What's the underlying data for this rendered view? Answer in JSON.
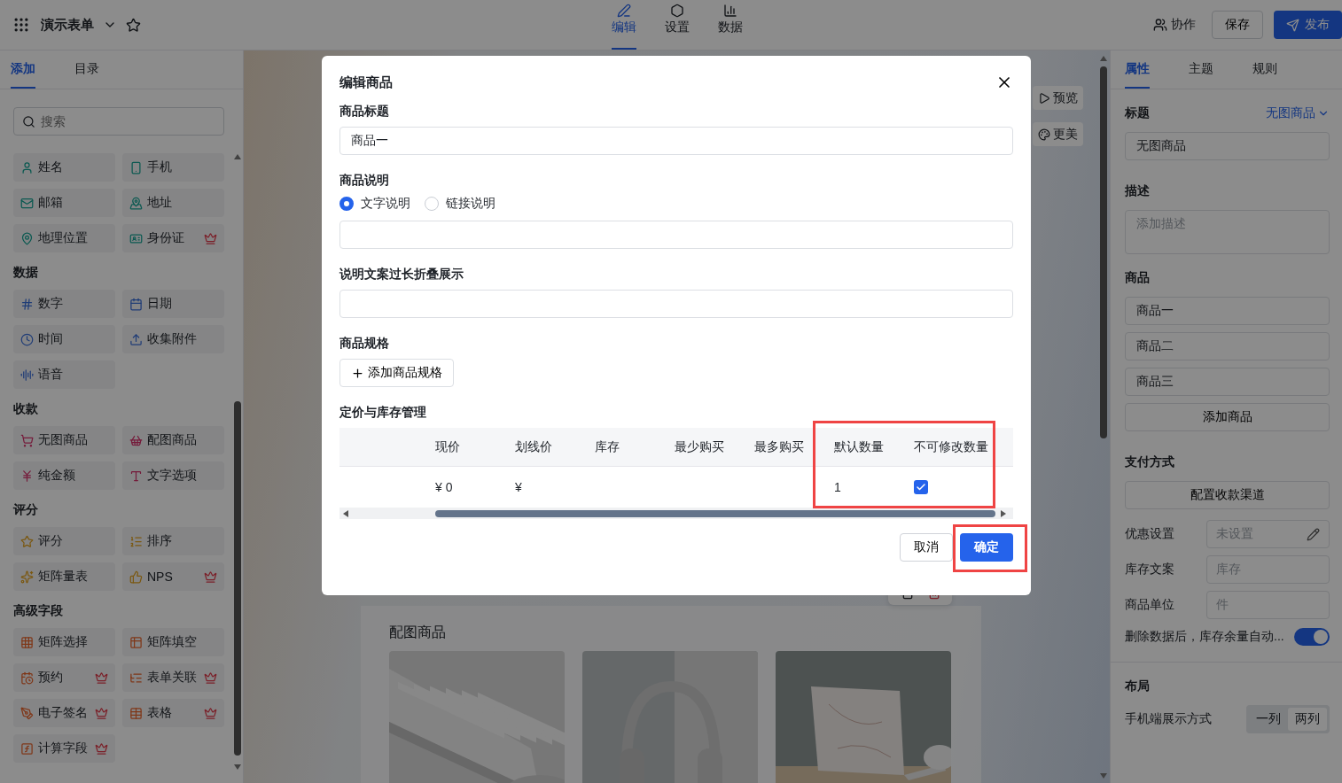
{
  "header": {
    "title": "演示表单",
    "mode_tabs": [
      {
        "label": "编辑",
        "selected": true
      },
      {
        "label": "设置",
        "selected": false
      },
      {
        "label": "数据",
        "selected": false
      }
    ],
    "collab": "协作",
    "save": "保存",
    "publish": "发布"
  },
  "sidebar": {
    "tabs": [
      {
        "label": "添加",
        "selected": true
      },
      {
        "label": "目录",
        "selected": false
      }
    ],
    "search": {
      "placeholder": "搜索"
    },
    "groups": [
      {
        "items": [
          {
            "label": "姓名",
            "premium": false
          },
          {
            "label": "手机",
            "premium": false
          },
          {
            "label": "邮箱",
            "premium": false
          },
          {
            "label": "地址",
            "premium": false
          },
          {
            "label": "地理位置",
            "premium": false
          },
          {
            "label": "身份证",
            "premium": true
          }
        ]
      },
      {
        "title": "数据",
        "items": [
          {
            "label": "数字",
            "premium": false
          },
          {
            "label": "日期",
            "premium": false
          },
          {
            "label": "时间",
            "premium": false
          },
          {
            "label": "收集附件",
            "premium": false
          },
          {
            "label": "语音",
            "premium": false
          }
        ]
      },
      {
        "title": "收款",
        "items": [
          {
            "label": "无图商品",
            "premium": false
          },
          {
            "label": "配图商品",
            "premium": false
          },
          {
            "label": "纯金额",
            "premium": false
          },
          {
            "label": "文字选项",
            "premium": false
          }
        ]
      },
      {
        "title": "评分",
        "items": [
          {
            "label": "评分",
            "premium": false
          },
          {
            "label": "排序",
            "premium": false
          },
          {
            "label": "矩阵量表",
            "premium": false
          },
          {
            "label": "NPS",
            "premium": true
          }
        ]
      },
      {
        "title": "高级字段",
        "items": [
          {
            "label": "矩阵选择",
            "premium": false
          },
          {
            "label": "矩阵填空",
            "premium": false
          },
          {
            "label": "预约",
            "premium": true
          },
          {
            "label": "表单关联",
            "premium": true
          },
          {
            "label": "电子签名",
            "premium": true
          },
          {
            "label": "表格",
            "premium": true
          },
          {
            "label": "计算字段",
            "premium": true
          }
        ]
      }
    ]
  },
  "canvas": {
    "side_buttons": [
      "预览",
      "更美"
    ],
    "card_title": "配图商品",
    "images": [
      {
        "kind": "picture"
      },
      {
        "kind": "picture"
      },
      {
        "kind": "picture"
      }
    ]
  },
  "modal": {
    "title": "编辑商品",
    "product_title": {
      "label": "商品标题",
      "value": "商品一"
    },
    "description": {
      "label": "商品说明",
      "options": [
        {
          "label": "文字说明",
          "selected": true
        },
        {
          "label": "链接说明",
          "selected": false
        }
      ]
    },
    "fold_text": {
      "label": "说明文案过长折叠展示"
    },
    "spec": {
      "label": "商品规格",
      "button": "添加商品规格"
    },
    "pricing": {
      "label": "定价与库存管理",
      "columns": [
        "现价",
        "划线价",
        "库存",
        "最少购买",
        "最多购买"
      ],
      "highlighted_columns": [
        "默认数量",
        "不可修改数量"
      ],
      "row": {
        "price": "¥ 0",
        "list_price": "¥",
        "default_qty": "1",
        "fixed_qty": true
      }
    },
    "cancel": "取消",
    "confirm": {
      "label": "确定",
      "highlighted": true
    }
  },
  "properties": {
    "tabs": [
      {
        "label": "属性",
        "selected": true
      },
      {
        "label": "主题",
        "selected": false
      },
      {
        "label": "规则",
        "selected": false
      }
    ],
    "title": {
      "label": "标题",
      "type": "无图商品",
      "value": "无图商品"
    },
    "description": {
      "label": "描述",
      "placeholder": "添加描述"
    },
    "products": {
      "label": "商品",
      "items": [
        "商品一",
        "商品二",
        "商品三"
      ],
      "add": "添加商品"
    },
    "payment": {
      "label": "支付方式",
      "button": "配置收款渠道"
    },
    "settings": [
      {
        "label": "优惠设置",
        "placeholder": "未设置",
        "kind": "edit"
      },
      {
        "label": "库存文案",
        "placeholder": "库存",
        "kind": "text"
      },
      {
        "label": "商品单位",
        "placeholder": "件",
        "kind": "text"
      }
    ],
    "auto_stock": {
      "label": "删除数据后，库存余量自动...",
      "on": true
    },
    "layout": {
      "label": "布局",
      "mobile_label": "手机端展示方式",
      "options": [
        {
          "label": "一列",
          "selected": false
        },
        {
          "label": "两列",
          "selected": true
        }
      ]
    }
  }
}
